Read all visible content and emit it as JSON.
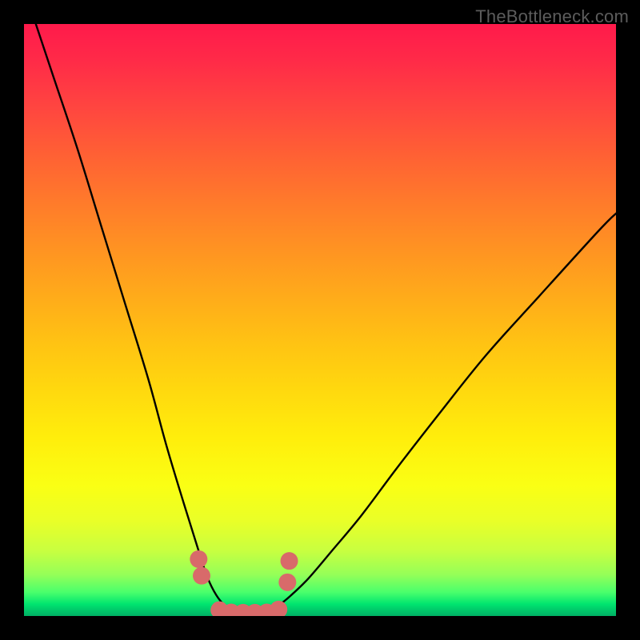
{
  "watermark": "TheBottleneck.com",
  "chart_data": {
    "type": "line",
    "title": "",
    "xlabel": "",
    "ylabel": "",
    "xlim": [
      0,
      100
    ],
    "ylim": [
      0,
      100
    ],
    "grid": false,
    "legend": false,
    "background_gradient": {
      "direction": "vertical",
      "stops": [
        {
          "pos": 0.0,
          "color": "#ff1a4b"
        },
        {
          "pos": 0.5,
          "color": "#ffb515"
        },
        {
          "pos": 0.78,
          "color": "#faff14"
        },
        {
          "pos": 0.95,
          "color": "#4aff6c"
        },
        {
          "pos": 1.0,
          "color": "#00b064"
        }
      ]
    },
    "series": [
      {
        "name": "bottleneck-curve-left",
        "color": "#000000",
        "x": [
          2,
          5,
          9,
          13,
          17,
          21,
          24,
          27,
          29.5,
          31,
          32.5,
          34,
          35.5
        ],
        "y": [
          100,
          91,
          79,
          66,
          53,
          40,
          29,
          19,
          11,
          6.5,
          3.5,
          1.7,
          0.8
        ]
      },
      {
        "name": "bottleneck-curve-right",
        "color": "#000000",
        "x": [
          41,
          43,
          45,
          48,
          52,
          57,
          63,
          70,
          78,
          87,
          97,
          100
        ],
        "y": [
          0.8,
          1.8,
          3.4,
          6.3,
          11,
          17,
          25,
          34,
          44,
          54,
          65,
          68
        ]
      },
      {
        "name": "bottleneck-bottom-markers",
        "color": "#d86a6a",
        "marker_size": 11,
        "x": [
          29.5,
          30.0,
          33.0,
          35.0,
          37.0,
          39.0,
          41.0,
          43.0,
          44.5,
          44.8
        ],
        "y": [
          9.6,
          6.8,
          1.0,
          0.6,
          0.55,
          0.55,
          0.6,
          1.1,
          5.7,
          9.3
        ]
      }
    ],
    "annotations": []
  }
}
